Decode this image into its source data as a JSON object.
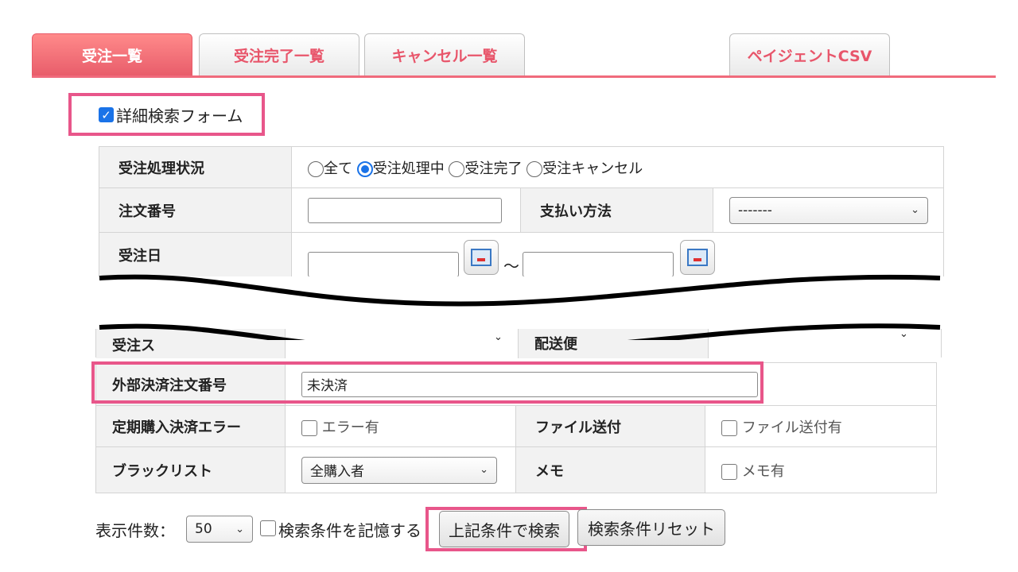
{
  "tabs": [
    {
      "label": "受注一覧",
      "active": true
    },
    {
      "label": "受注完了一覧",
      "active": false
    },
    {
      "label": "キャンセル一覧",
      "active": false
    },
    {
      "label": "ペイジェントCSV",
      "active": false
    }
  ],
  "detail_toggle": {
    "label": "詳細検索フォーム",
    "checked": true
  },
  "form": {
    "status_label": "受注処理状況",
    "status_options": [
      "全て",
      "受注処理中",
      "受注完了",
      "受注キャンセル"
    ],
    "status_selected": "受注処理中",
    "order_no_label": "注文番号",
    "payment_label": "支払い方法",
    "payment_value": "-------",
    "order_date_label": "受注日",
    "range_sep": "～",
    "status2_label": "受注ス",
    "shipping_label": "配送便",
    "ext_order_label": "外部決済注文番号",
    "ext_order_value": "未決済",
    "sub_error_label": "定期購入決済エラー",
    "sub_error_cb": "エラー有",
    "file_label": "ファイル送付",
    "file_cb": "ファイル送付有",
    "blacklist_label": "ブラックリスト",
    "blacklist_value": "全購入者",
    "memo_label": "メモ",
    "memo_cb": "メモ有"
  },
  "footer": {
    "count_label": "表示件数：",
    "count_value": "50",
    "remember_label": "検索条件を記憶する",
    "search_button": "上記条件で検索",
    "reset_button": "検索条件リセット"
  },
  "colors": {
    "accent": "#f06b7c",
    "highlight": "#e8568a",
    "radio": "#1a73e8"
  }
}
